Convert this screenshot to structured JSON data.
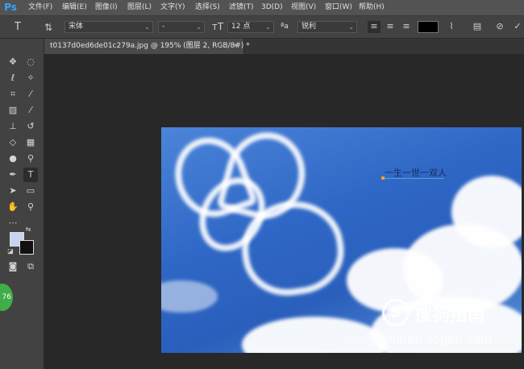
{
  "app": {
    "logo": "Ps"
  },
  "menu": [
    "文件(F)",
    "编辑(E)",
    "图像(I)",
    "图层(L)",
    "文字(Y)",
    "选择(S)",
    "滤镜(T)",
    "3D(D)",
    "视图(V)",
    "窗口(W)",
    "帮助(H)"
  ],
  "options": {
    "tool_icon": "type-tool-icon",
    "font_family": "宋体",
    "font_style": "-",
    "font_size": "12 点",
    "aa_label": "ªa",
    "antialias": "锐利",
    "color": "#000000"
  },
  "document_tab": {
    "title": "t0137d0ed6de01c279a.jpg @ 195% (图层 2, RGB/8#) *",
    "close": "×"
  },
  "canvas": {
    "text_layer": "一生一世一双人",
    "watermark_logo": "S",
    "watermark_text": "搜狗指南",
    "watermark_url": "zhinan.sogou.com"
  },
  "toolbox": {
    "fg_color": "#c8d4f0",
    "bg_color": "#111111",
    "badge_text": "76"
  }
}
